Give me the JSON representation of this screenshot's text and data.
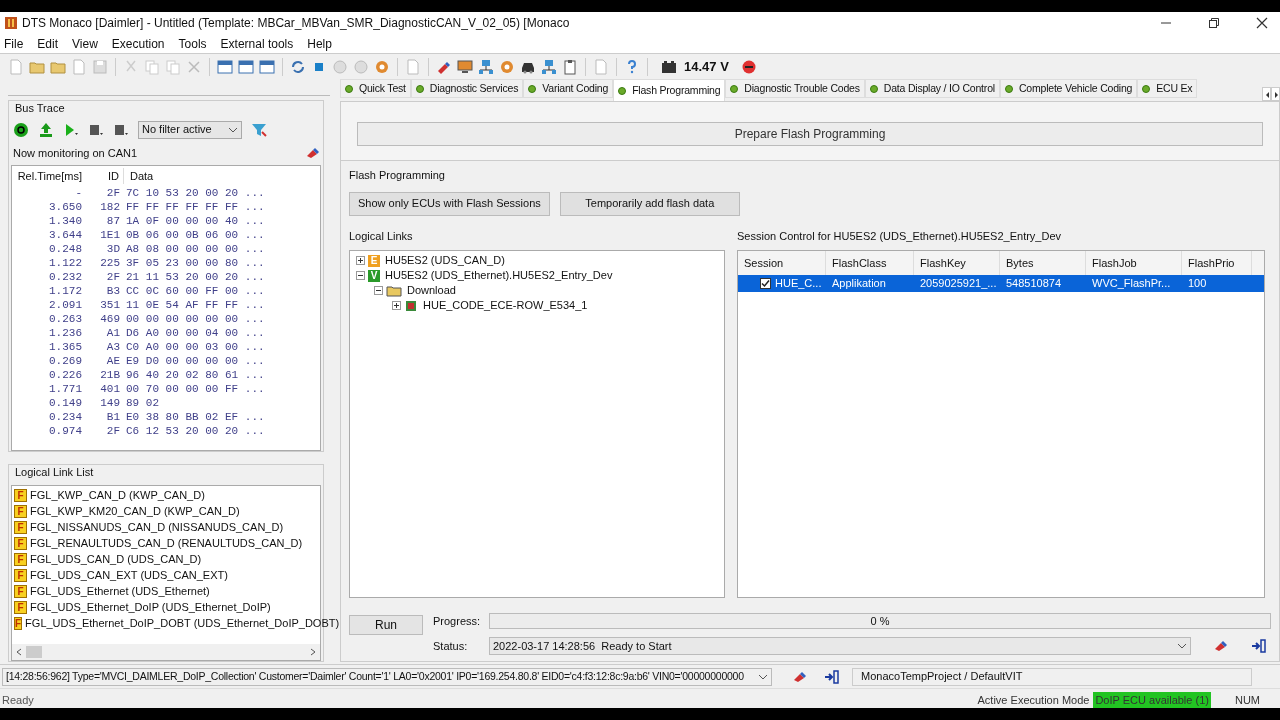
{
  "window": {
    "title": "DTS Monaco [Daimler] - Untitled (Template: MBCar_MBVan_SMR_DiagnosticCAN_V_02_05) [Monaco"
  },
  "menu": [
    "File",
    "Edit",
    "View",
    "Execution",
    "Tools",
    "External tools",
    "Help"
  ],
  "toolbar": {
    "voltage": "14.47 V"
  },
  "bus_trace": {
    "title": "Bus Trace",
    "filter": "No filter active",
    "monitoring": "Now monitoring on CAN1",
    "columns": [
      "Rel.Time[ms]",
      "ID",
      "Data"
    ],
    "rows": [
      {
        "time": "-",
        "id": "2F",
        "data": "7C 10 53 20 00 20 ..."
      },
      {
        "time": "3.650",
        "id": "182",
        "data": "FF FF FF FF FF FF ..."
      },
      {
        "time": "1.340",
        "id": "87",
        "data": "1A 0F 00 00 00 40 ..."
      },
      {
        "time": "3.644",
        "id": "1E1",
        "data": "0B 06 00 0B 06 00 ..."
      },
      {
        "time": "0.248",
        "id": "3D",
        "data": "A8 08 00 00 00 00 ..."
      },
      {
        "time": "1.122",
        "id": "225",
        "data": "3F 05 23 00 00 80 ..."
      },
      {
        "time": "0.232",
        "id": "2F",
        "data": "21 11 53 20 00 20 ..."
      },
      {
        "time": "1.172",
        "id": "B3",
        "data": "CC 0C 60 00 FF 00 ..."
      },
      {
        "time": "2.091",
        "id": "351",
        "data": "11 0E 54 AF FF FF ..."
      },
      {
        "time": "0.263",
        "id": "469",
        "data": "00 00 00 00 00 00 ..."
      },
      {
        "time": "1.236",
        "id": "A1",
        "data": "D6 A0 00 00 04 00 ..."
      },
      {
        "time": "1.365",
        "id": "A3",
        "data": "C0 A0 00 00 03 00 ..."
      },
      {
        "time": "0.269",
        "id": "AE",
        "data": "E9 D0 00 00 00 00 ..."
      },
      {
        "time": "0.226",
        "id": "21B",
        "data": "96 40 20 02 80 61 ..."
      },
      {
        "time": "1.771",
        "id": "401",
        "data": "00 70 00 00 00 FF ..."
      },
      {
        "time": "0.149",
        "id": "149",
        "data": "89 02"
      },
      {
        "time": "0.234",
        "id": "B1",
        "data": "E0 38 80 BB 02 EF ..."
      },
      {
        "time": "0.974",
        "id": "2F",
        "data": "C6 12 53 20 00 20 ..."
      }
    ]
  },
  "logical_link_list": {
    "title": "Logical Link List",
    "items": [
      {
        "badge": "F",
        "label": "FGL_KWP_CAN_D (KWP_CAN_D)"
      },
      {
        "badge": "F",
        "label": "FGL_KWP_KM20_CAN_D (KWP_CAN_D)"
      },
      {
        "badge": "F",
        "label": "FGL_NISSANUDS_CAN_D (NISSANUDS_CAN_D)"
      },
      {
        "badge": "F",
        "label": "FGL_RENAULTUDS_CAN_D (RENAULTUDS_CAN_D)"
      },
      {
        "badge": "F",
        "label": "FGL_UDS_CAN_D (UDS_CAN_D)"
      },
      {
        "badge": "F",
        "label": "FGL_UDS_CAN_EXT (UDS_CAN_EXT)"
      },
      {
        "badge": "F",
        "label": "FGL_UDS_Ethernet (UDS_Ethernet)"
      },
      {
        "badge": "F",
        "label": "FGL_UDS_Ethernet_DoIP (UDS_Ethernet_DoIP)"
      },
      {
        "badge": "F",
        "label": "FGL_UDS_Ethernet_DoIP_DOBT (UDS_Ethernet_DoIP_DOBT)"
      }
    ]
  },
  "tabs": [
    {
      "label": "Quick Test",
      "selected": false
    },
    {
      "label": "Diagnostic Services",
      "selected": false
    },
    {
      "label": "Variant Coding",
      "selected": false
    },
    {
      "label": "Flash Programming",
      "selected": true
    },
    {
      "label": "Diagnostic Trouble Codes",
      "selected": false
    },
    {
      "label": "Data Display / IO Control",
      "selected": false
    },
    {
      "label": "Complete Vehicle Coding",
      "selected": false
    },
    {
      "label": "ECU Ex",
      "selected": false
    }
  ],
  "prepare_button": "Prepare Flash Programming",
  "flash_programming": {
    "title": "Flash Programming",
    "buttons": [
      "Show only ECUs with Flash Sessions",
      "Temporarily add flash data"
    ],
    "logical_links": {
      "title": "Logical Links",
      "tree": [
        {
          "kind": "ecu",
          "badge": "E",
          "color": "#f0a020",
          "label": "HU5ES2 (UDS_CAN_D)",
          "expanded": false
        },
        {
          "kind": "ecu",
          "badge": "V",
          "color": "#2a9a2a",
          "label": "HU5ES2 (UDS_Ethernet).HU5ES2_Entry_Dev",
          "expanded": true,
          "children": [
            {
              "kind": "folder",
              "label": "Download",
              "expanded": true,
              "children": [
                {
                  "kind": "file",
                  "label": "HUE_CODE_ECE-ROW_E534_1",
                  "expanded": false
                }
              ]
            }
          ]
        }
      ]
    },
    "session_control": {
      "title": "Session Control for HU5ES2 (UDS_Ethernet).HU5ES2_Entry_Dev",
      "columns": [
        "Session",
        "FlashClass",
        "FlashKey",
        "Bytes",
        "FlashJob",
        "FlashPrio"
      ],
      "rows": [
        {
          "checked": true,
          "selected": true,
          "cells": [
            "HUE_C...",
            "Applikation",
            "2059025921_...",
            "548510874",
            "WVC_FlashPr...",
            "100"
          ]
        }
      ]
    },
    "run_button": "Run",
    "progress_label": "Progress:",
    "progress": {
      "level": 0,
      "text": "0 %"
    },
    "status_label": "Status:",
    "status": "2022-03-17 14:28:56  Ready to Start"
  },
  "status_bar": {
    "log": "[14:28:56:962] Type='MVCI_DAIMLER_DoIP_Collection' Customer='Daimler' Count='1' LA0='0x2001' IP0='169.254.80.8' EID0='c4:f3:12:8c:9a:b6' VIN0='00000000000",
    "project": "MonacoTempProject / DefaultVIT"
  },
  "bottom_line": {
    "state": "Ready",
    "mode_label": "Active Execution Mode",
    "mode": "DoIP ECU available (1)",
    "num": "NUM"
  }
}
